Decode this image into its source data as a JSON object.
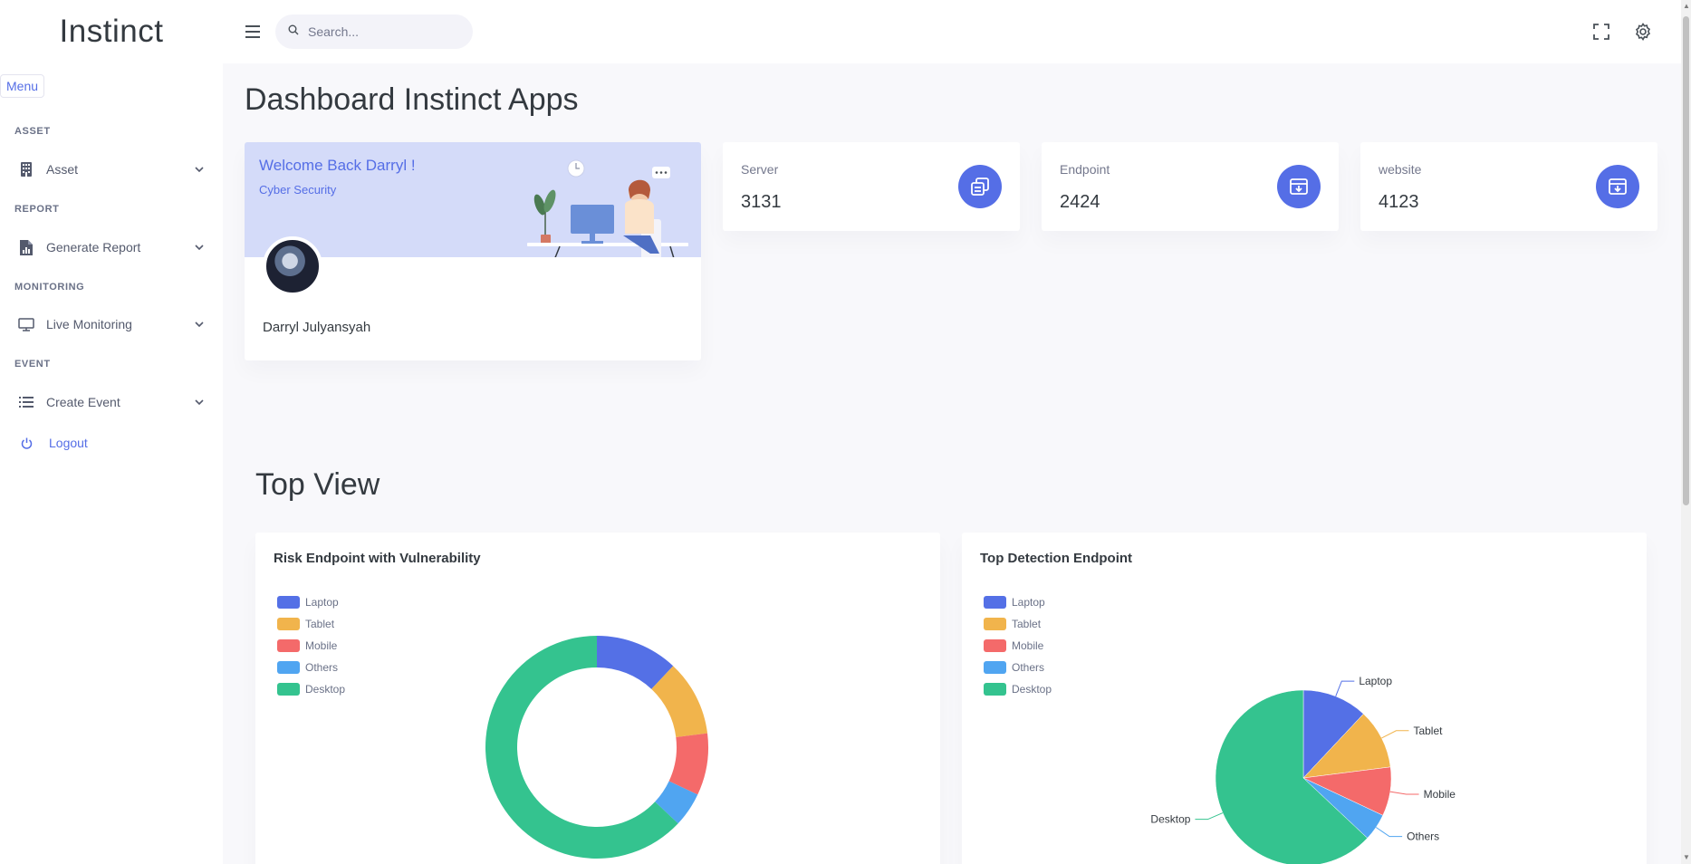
{
  "topbar": {
    "brand": "Instinct",
    "search_placeholder": "Search..."
  },
  "sidebar": {
    "menu_chip": "Menu",
    "sections": [
      {
        "title": "ASSET",
        "item": "Asset",
        "icon": "building-icon"
      },
      {
        "title": "REPORT",
        "item": "Generate Report",
        "icon": "report-icon"
      },
      {
        "title": "MONITORING",
        "item": "Live Monitoring",
        "icon": "monitor-icon"
      },
      {
        "title": "EVENT",
        "item": "Create Event",
        "icon": "list-icon"
      }
    ],
    "logout": "Logout"
  },
  "main": {
    "title": "Dashboard Instinct Apps",
    "welcome": {
      "title": "Welcome Back Darryl !",
      "subtitle": "Cyber Security",
      "name": "Darryl Julyansyah"
    },
    "stats": [
      {
        "label": "Server",
        "value": "3131",
        "icon": "copy-icon"
      },
      {
        "label": "Endpoint",
        "value": "2424",
        "icon": "archive-icon"
      },
      {
        "label": "website",
        "value": "4123",
        "icon": "archive-icon"
      }
    ],
    "top_view_title": "Top View"
  },
  "colors": {
    "accent": "#556ee6",
    "laptop": "#5470e6",
    "tablet": "#f1b44c",
    "mobile": "#f46a6a",
    "others": "#50a5f1",
    "desktop": "#34c38f"
  },
  "chart_data": [
    {
      "type": "pie",
      "variant": "donut",
      "title": "Risk Endpoint with Vulnerability",
      "legend": [
        "Laptop",
        "Tablet",
        "Mobile",
        "Others",
        "Desktop"
      ],
      "categories": [
        "Laptop",
        "Tablet",
        "Mobile",
        "Others",
        "Desktop"
      ],
      "values": [
        12,
        11,
        9,
        5,
        63
      ],
      "legend_position": "top-left"
    },
    {
      "type": "pie",
      "title": "Top Detection Endpoint",
      "legend": [
        "Laptop",
        "Tablet",
        "Mobile",
        "Others",
        "Desktop"
      ],
      "categories": [
        "Laptop",
        "Tablet",
        "Mobile",
        "Others",
        "Desktop"
      ],
      "values": [
        12,
        11,
        9,
        5,
        63
      ],
      "legend_position": "top-left"
    }
  ]
}
